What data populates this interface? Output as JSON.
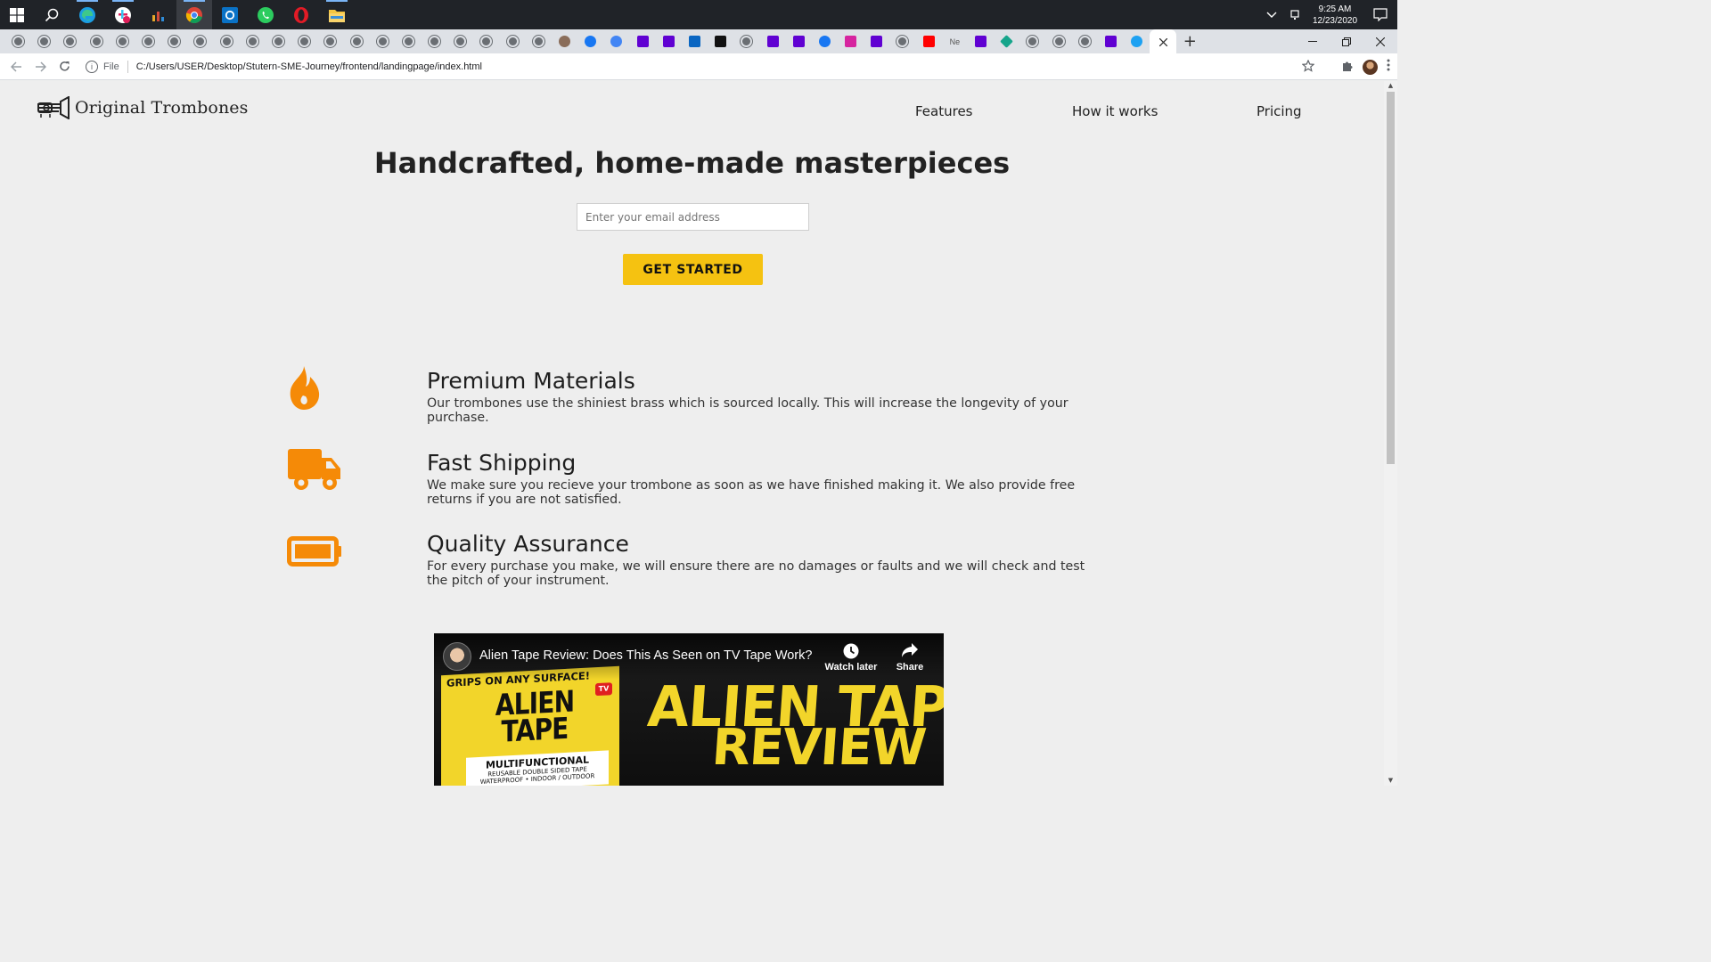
{
  "taskbar": {
    "clock_time": "9:25 AM",
    "clock_date": "12/23/2020",
    "apps": [
      "start-icon",
      "search-icon",
      "edge-icon",
      "slack-icon",
      "chart-app-icon",
      "chrome-icon",
      "outlook-icon",
      "whatsapp-icon",
      "opera-icon",
      "file-explorer-icon"
    ]
  },
  "browser": {
    "tab_new_label": "+",
    "tab_text_label": "Ne",
    "address_scheme": "File",
    "address_url": "C:/Users/USER/Desktop/Stutern-SME-Journey/frontend/landingpage/index.html"
  },
  "site": {
    "logo_text": "Original Trombones",
    "nav": {
      "features": "Features",
      "how_it_works": "How it works",
      "pricing": "Pricing"
    },
    "hero": {
      "title": "Handcrafted, home-made masterpieces",
      "email_placeholder": "Enter your email address",
      "cta_label": "GET STARTED"
    },
    "features": [
      {
        "icon": "fire-icon",
        "title": "Premium Materials",
        "description": "Our trombones use the shiniest brass which is sourced locally. This will increase the longevity of your purchase."
      },
      {
        "icon": "truck-icon",
        "title": "Fast Shipping",
        "description": "We make sure you recieve your trombone as soon as we have finished making it. We also provide free returns if you are not satisfied."
      },
      {
        "icon": "battery-icon",
        "title": "Quality Assurance",
        "description": "For every purchase you make, we will ensure there are no damages or faults and we will check and test the pitch of your instrument."
      }
    ],
    "video": {
      "title": "Alien Tape Review: Does This As Seen on TV Tape Work?",
      "watch_later": "Watch later",
      "share": "Share",
      "thumb_top": "GRIPS ON ANY SURFACE!",
      "thumb_tv": "TV",
      "thumb_brand": "ALIEN TAPE",
      "thumb_label": "MULTIFUNCTIONAL",
      "thumb_label_sub": "REUSABLE DOUBLE SIDED TAPE",
      "thumb_label_sub2": "WATERPROOF • INDOOR / OUTDOOR",
      "thumb_big1": "ALIEN TAP",
      "thumb_big2": "REVIEW"
    }
  },
  "colors": {
    "accent_orange": "#f58a07",
    "cta_yellow": "#f5c211",
    "page_bg": "#eeeeee"
  }
}
